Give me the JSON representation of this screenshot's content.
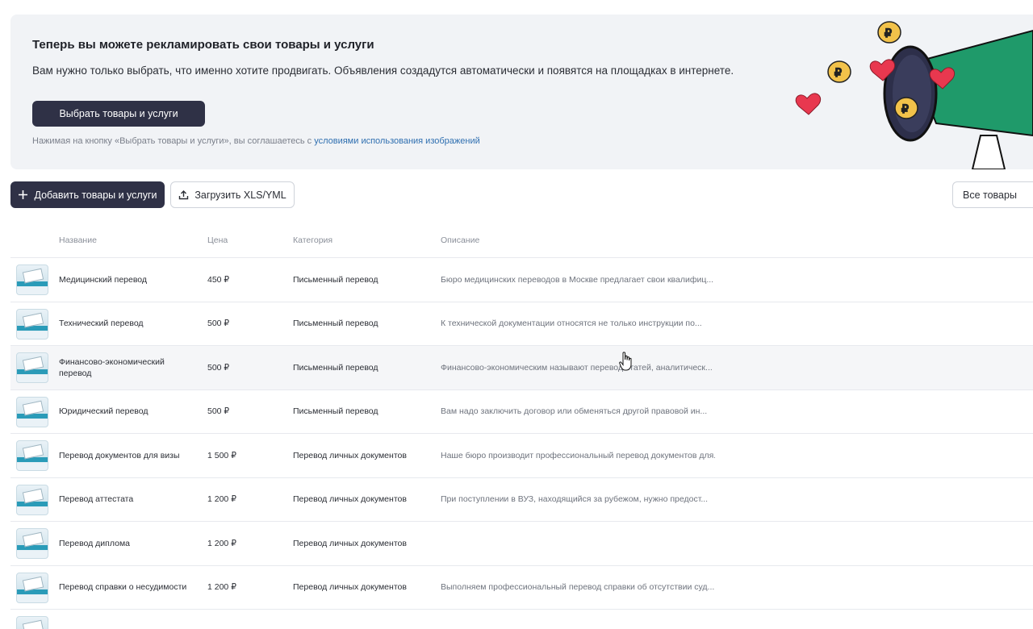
{
  "banner": {
    "title": "Теперь вы можете рекламировать свои товары и услуги",
    "text": "Вам нужно только выбрать, что именно хотите продвигать. Объявления создадутся автоматически и появятся на площадках в интернете.",
    "button_label": "Выбрать товары и услуги",
    "note_prefix": "Нажимая на кнопку «Выбрать товары и услуги», вы соглашаетесь с ",
    "note_link": "условиями использования изображений"
  },
  "toolbar": {
    "add_label": "Добавить товары и услуги",
    "upload_label": "Загрузить XLS/YML",
    "filter_value": "Все товары"
  },
  "table": {
    "headers": {
      "name": "Название",
      "price": "Цена",
      "category": "Категория",
      "description": "Описание"
    },
    "rows": [
      {
        "name": "Медицинский перевод",
        "price": "450 ₽",
        "category": "Письменный перевод",
        "description": "Бюро медицинских переводов в Москве предлагает свои квалифиц..."
      },
      {
        "name": "Технический перевод",
        "price": "500 ₽",
        "category": "Письменный перевод",
        "description": "К технической документации относятся не только инструкции по..."
      },
      {
        "name": "Финансово-экономический перевод",
        "price": "500 ₽",
        "category": "Письменный перевод",
        "description": "Финансово-экономическим называют перевод статей, аналитическ..."
      },
      {
        "name": "Юридический перевод",
        "price": "500 ₽",
        "category": "Письменный перевод",
        "description": "Вам надо заключить договор или обменяться другой правовой ин..."
      },
      {
        "name": "Перевод документов для визы",
        "price": "1 500 ₽",
        "category": "Перевод личных документов",
        "description": "Наше бюро производит профессиональный перевод документов для..."
      },
      {
        "name": "Перевод аттестата",
        "price": "1 200 ₽",
        "category": "Перевод личных документов",
        "description": "При поступлении в ВУЗ, находящийся за рубежом, нужно предост..."
      },
      {
        "name": "Перевод диплома",
        "price": "1 200 ₽",
        "category": "Перевод личных документов",
        "description": ""
      },
      {
        "name": "Перевод справки о несудимости",
        "price": "1 200 ₽",
        "category": "Перевод личных документов",
        "description": "Выполняем профессиональный перевод справки об отсутствии суд..."
      }
    ]
  },
  "colors": {
    "primary_button": "#2f3146",
    "link": "#2f6fb0",
    "banner_bg": "#f1f3f6",
    "megaphone": "#1f9a6a",
    "heart": "#e8384f",
    "coin": "#f2c24a"
  }
}
